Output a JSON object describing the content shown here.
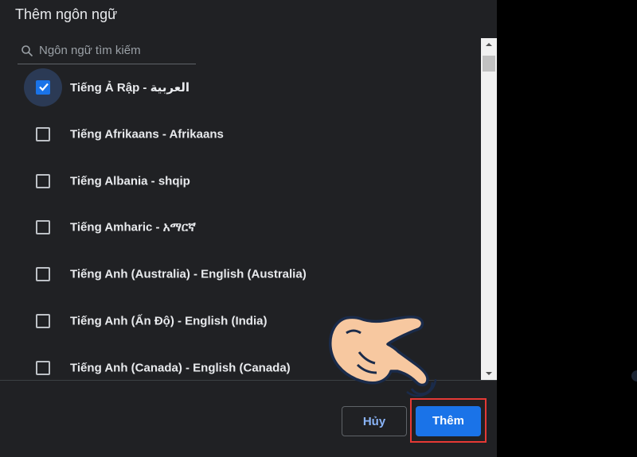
{
  "dialog": {
    "title": "Thêm ngôn ngữ"
  },
  "search": {
    "placeholder": "Ngôn ngữ tìm kiếm",
    "icon": "search-icon"
  },
  "languages": [
    {
      "label": "Tiếng Ả Rập - العربية",
      "checked": true
    },
    {
      "label": "Tiếng Afrikaans - Afrikaans",
      "checked": false
    },
    {
      "label": "Tiếng Albania - shqip",
      "checked": false
    },
    {
      "label": "Tiếng Amharic - አማርኛ",
      "checked": false
    },
    {
      "label": "Tiếng Anh (Australia) - English (Australia)",
      "checked": false
    },
    {
      "label": "Tiếng Anh (Ấn Độ) - English (India)",
      "checked": false
    },
    {
      "label": "Tiếng Anh (Canada) - English (Canada)",
      "checked": false
    }
  ],
  "buttons": {
    "cancel_label": "Hủy",
    "add_label": "Thêm"
  },
  "colors": {
    "accent": "#1a73e8",
    "highlight": "#e53935",
    "dialog_bg": "#202124"
  }
}
